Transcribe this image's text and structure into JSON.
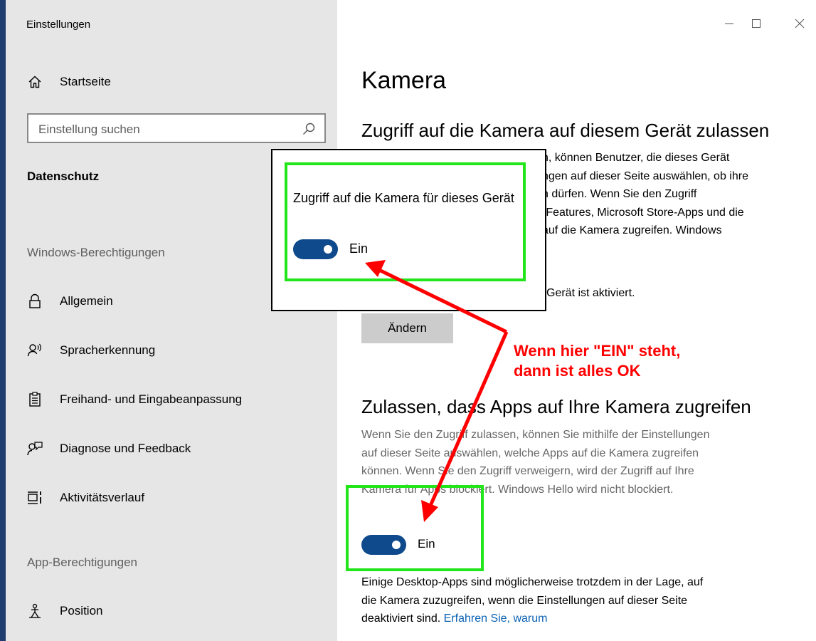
{
  "window": {
    "title": "Einstellungen",
    "controls": {
      "minimize": "minimize-icon",
      "maximize": "maximize-icon",
      "close": "close-icon"
    }
  },
  "sidebar": {
    "home_label": "Startseite",
    "search_placeholder": "Einstellung suchen",
    "category": "Datenschutz",
    "section_windows": "Windows-Berechtigungen",
    "windows_items": [
      {
        "label": "Allgemein",
        "icon": "lock-icon"
      },
      {
        "label": "Spracherkennung",
        "icon": "speech-icon"
      },
      {
        "label": "Freihand- und Eingabeanpassung",
        "icon": "clipboard-icon"
      },
      {
        "label": "Diagnose und Feedback",
        "icon": "feedback-icon"
      },
      {
        "label": "Aktivitätsverlauf",
        "icon": "timeline-icon"
      }
    ],
    "section_apps": "App-Berechtigungen",
    "app_items": [
      {
        "label": "Position",
        "icon": "location-person-icon"
      }
    ]
  },
  "main": {
    "title": "Kamera",
    "section1": {
      "heading": "Zugriff auf die Kamera auf diesem Gerät zulassen",
      "lines": [
        "n, können Benutzer, die dieses Gerät",
        "ngen auf dieser Seite auswählen, ob ihre",
        "n dürfen. Wenn Sie den Zugriff",
        "-Features, Microsoft Store-Apps und die",
        "auf die Kamera zugreifen. Windows"
      ],
      "status_fragment": "Gerät ist aktiviert.",
      "change_button": "Ändern"
    },
    "section2": {
      "heading": "Zulassen, dass Apps auf Ihre Kamera zugreifen",
      "description_lines": [
        "Wenn Sie den Zugriff zulassen, können Sie mithilfe der Einstellungen",
        "auf dieser Seite auswählen, welche Apps auf die Kamera zugreifen",
        "können. Wenn Sie den Zugriff verweigern, wird der Zugriff auf Ihre",
        "Kamera für Apps blockiert. Windows Hello wird nicht blockiert."
      ],
      "toggle_state": "Ein",
      "toggle_on": true,
      "note_lines": [
        "Einige Desktop-Apps sind möglicherweise trotzdem in der Lage, auf",
        "die Kamera zuzugreifen, wenn die Einstellungen auf dieser Seite"
      ],
      "note_last_text": "deaktiviert sind.",
      "note_link": "Erfahren Sie, warum"
    }
  },
  "popup": {
    "label": "Zugriff auf die Kamera für dieses Gerät",
    "toggle_state": "Ein",
    "toggle_on": true
  },
  "annotation": {
    "line1": "Wenn hier \"EIN\" steht,",
    "line2": "dann ist alles OK",
    "color": "#ff0000"
  },
  "colors": {
    "accent": "#0e4a8c",
    "highlight": "#22e51a",
    "link": "#0b62b3",
    "sidebar_bg": "#e6e6e6"
  }
}
